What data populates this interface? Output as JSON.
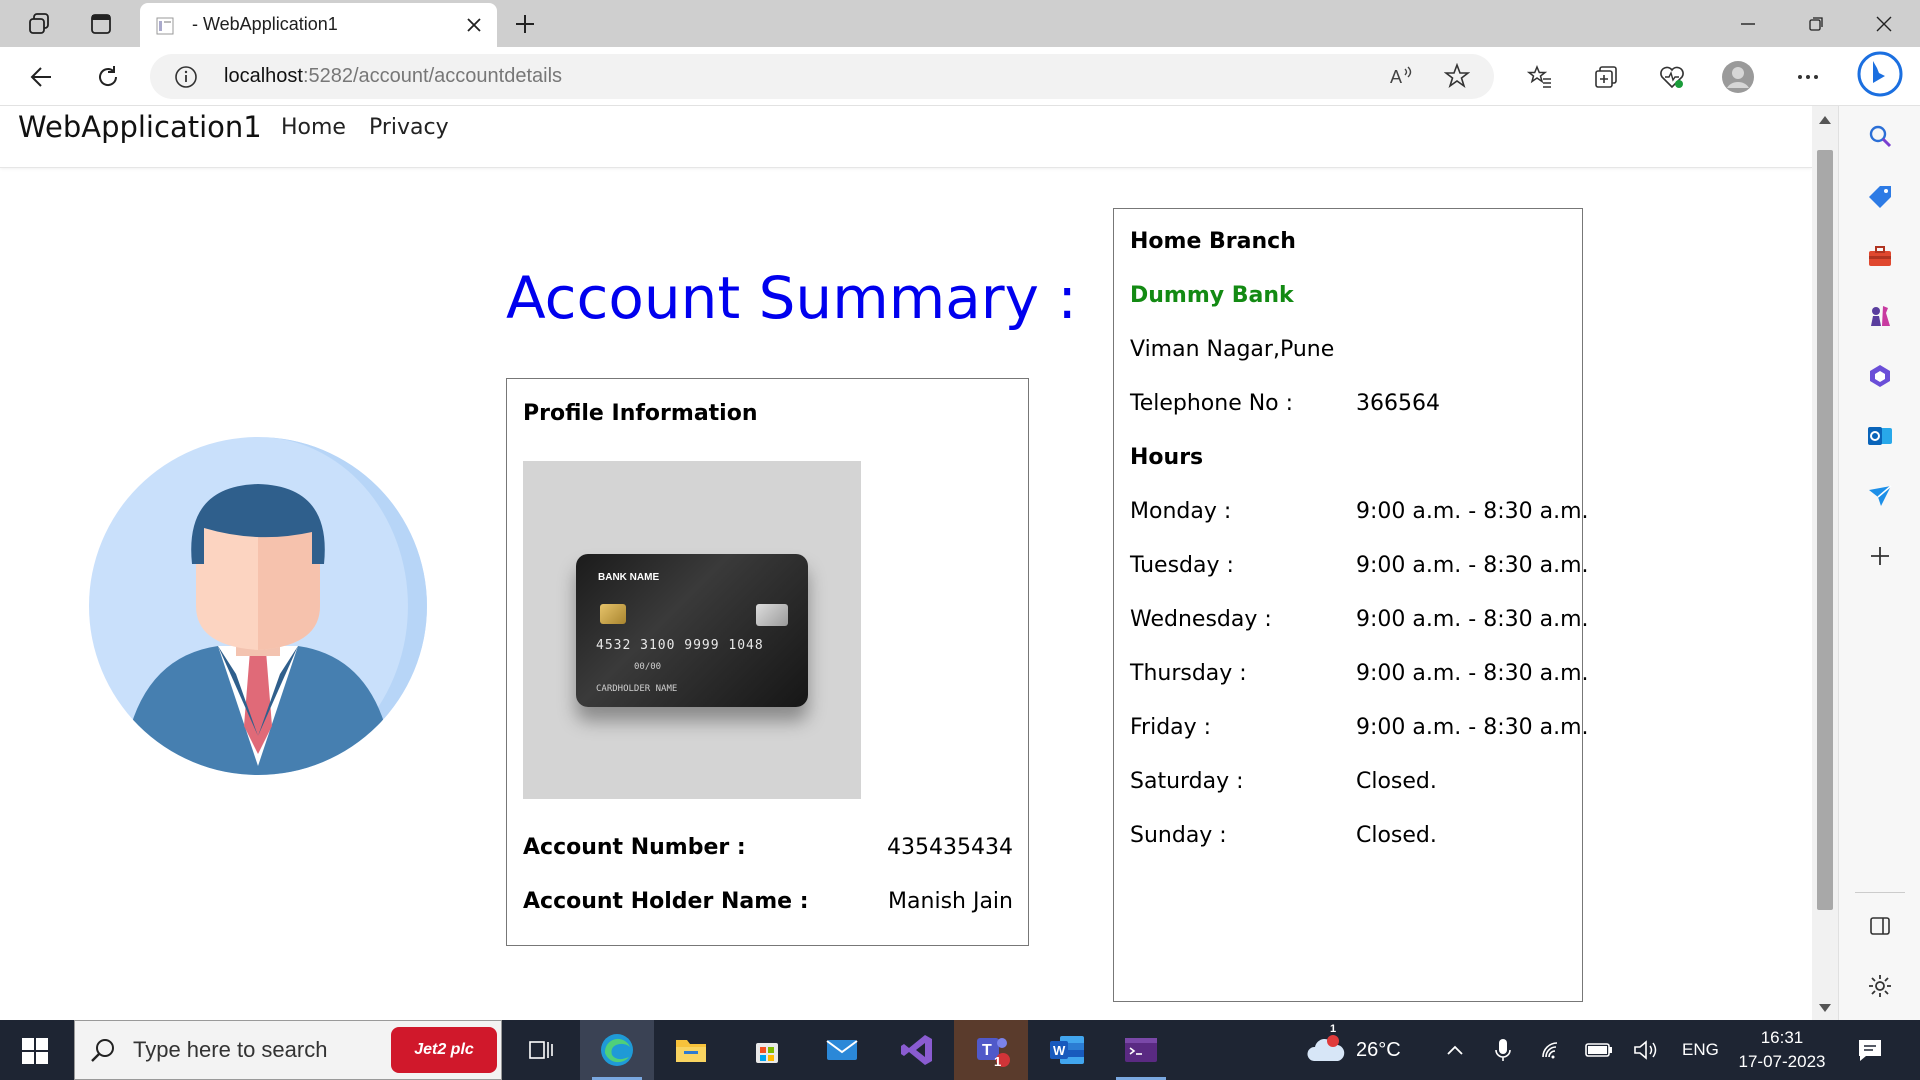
{
  "browser": {
    "tab_title": "- WebApplication1",
    "url_host": "localhost",
    "url_path": ":5282/account/accountdetails"
  },
  "navbar": {
    "brand": "WebApplication1",
    "links": [
      "Home",
      "Privacy"
    ]
  },
  "main": {
    "heading": "Account Summary :",
    "profile": {
      "title": "Profile Information",
      "card": {
        "bank_name": "BANK NAME",
        "number": "4532 3100 9999 1048",
        "expiry": "00/00",
        "holder": "CARDHOLDER NAME"
      },
      "account_number_label": "Account Number :",
      "account_number": "435435434",
      "holder_label": "Account Holder Name :",
      "holder_name": "Manish Jain"
    },
    "branch": {
      "title": "Home Branch",
      "bank_name": "Dummy Bank",
      "address": "Viman Nagar,Pune",
      "telephone_label": "Telephone No :",
      "telephone": "366564",
      "hours_title": "Hours",
      "hours": [
        {
          "day": "Monday :",
          "time": "9:00 a.m. - 8:30 a.m."
        },
        {
          "day": "Tuesday :",
          "time": "9:00 a.m. - 8:30 a.m."
        },
        {
          "day": "Wednesday :",
          "time": "9:00 a.m. - 8:30 a.m."
        },
        {
          "day": "Thursday :",
          "time": "9:00 a.m. - 8:30 a.m."
        },
        {
          "day": "Friday :",
          "time": "9:00 a.m. - 8:30 a.m."
        },
        {
          "day": "Saturday :",
          "time": "Closed."
        },
        {
          "day": "Sunday :",
          "time": "Closed."
        }
      ]
    }
  },
  "taskbar": {
    "search_placeholder": "Type here to search",
    "search_promo": "Jet2 plc",
    "weather": "26°C",
    "weather_badge": "1",
    "teams_badge": "1",
    "language": "ENG",
    "time": "16:31",
    "date": "17-07-2023"
  },
  "colors": {
    "heading": "#0000ee",
    "bank_name": "#138a13",
    "taskbar": "#1e2533"
  }
}
